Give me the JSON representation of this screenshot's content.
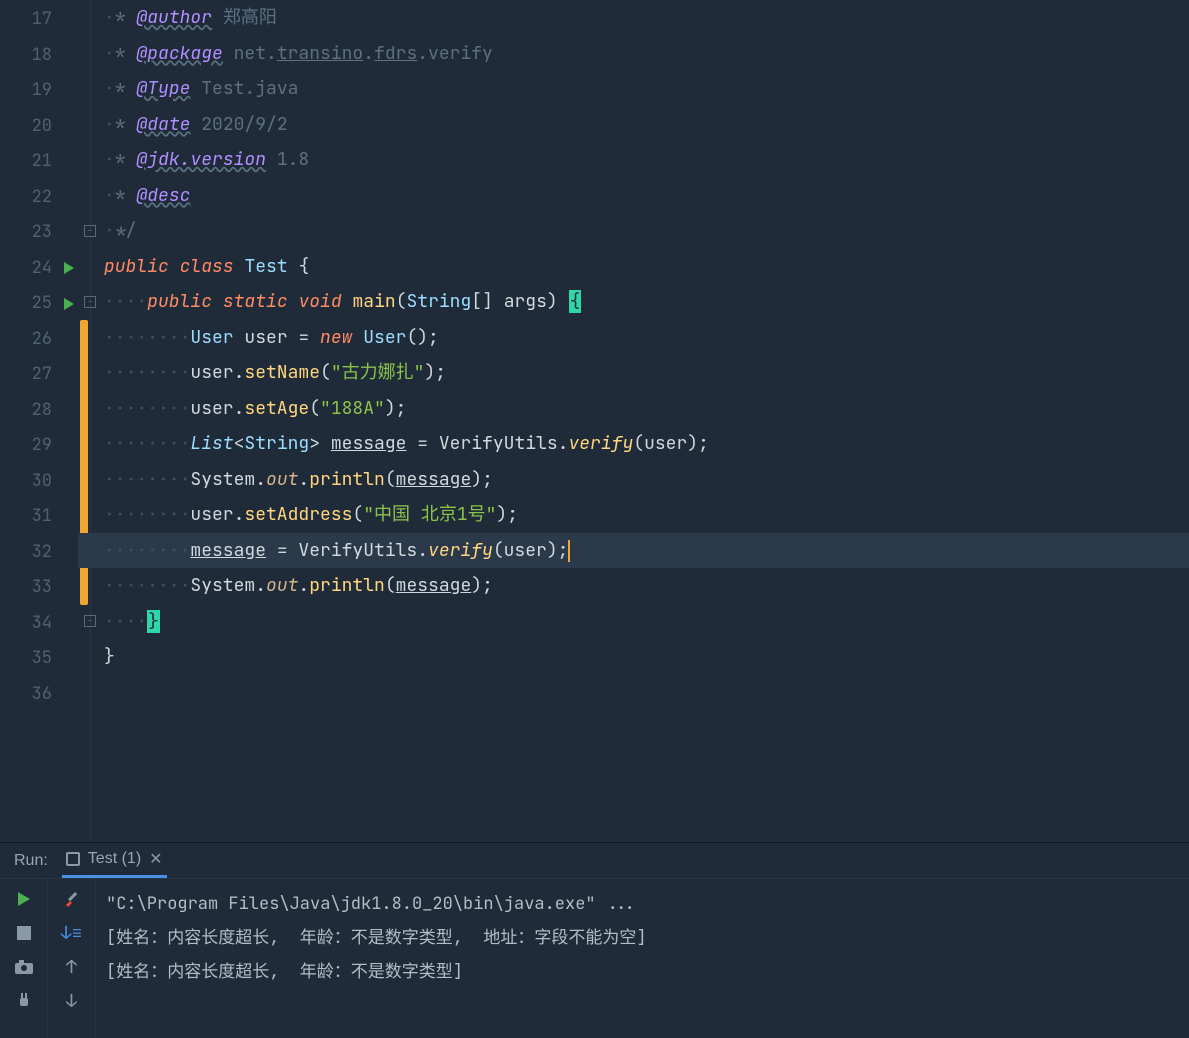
{
  "editor": {
    "first_line_no": 17,
    "lines": [
      {
        "no": 17,
        "html": "<span class='dots'>·</span><span class='comment'>* </span><span class='doctag'>@author</span><span class='comment'> 郑高阳</span>"
      },
      {
        "no": 18,
        "html": "<span class='dots'>·</span><span class='comment'>* </span><span class='doctag'>@package</span><span class='comment'> net.<span class='underline'>transino</span>.<span class='underline'>fdrs</span>.verify</span>"
      },
      {
        "no": 19,
        "html": "<span class='dots'>·</span><span class='comment'>* </span><span class='doctag'>@Type</span><span class='comment'> Test.java</span>"
      },
      {
        "no": 20,
        "html": "<span class='dots'>·</span><span class='comment'>* </span><span class='doctag'>@date</span><span class='comment'> 2020/9/2</span>"
      },
      {
        "no": 21,
        "html": "<span class='dots'>·</span><span class='comment'>* </span><span class='doctag'>@jdk.version</span><span class='comment'> 1.8</span>"
      },
      {
        "no": 22,
        "html": "<span class='dots'>·</span><span class='comment'>* </span><span class='doctag'>@desc</span>"
      },
      {
        "no": 23,
        "fold": "-",
        "html": "<span class='dots'>·</span><span class='comment'>*/</span>"
      },
      {
        "no": 24,
        "play": true,
        "html": "<span class='kw'>public</span> <span class='kw'>class</span> <span class='type'>Test</span> <span class='var'>{</span>"
      },
      {
        "no": 25,
        "play": true,
        "fold": "-",
        "html": "<span class='dots'>····</span><span class='kw'>public</span> <span class='kw'>static</span> <span class='kw'>void</span> <span class='method'>main</span><span class='var'>(</span><span class='type'>String</span><span class='var'>[] args) </span><span class='bracehl'>{</span>"
      },
      {
        "no": 26,
        "html": "<span class='dots'>········</span><span class='type'>User</span> <span class='var'>user = </span><span class='kw'>new</span> <span class='type'>User</span><span class='var'>();</span>"
      },
      {
        "no": 27,
        "html": "<span class='dots'>········</span><span class='var'>user.</span><span class='method'>setName</span><span class='var'>(</span><span class='str'>\"古力娜扎\"</span><span class='var'>);</span>"
      },
      {
        "no": 28,
        "html": "<span class='dots'>········</span><span class='var'>user.</span><span class='method'>setAge</span><span class='var'>(</span><span class='str'>\"188A\"</span><span class='var'>);</span>"
      },
      {
        "no": 29,
        "html": "<span class='dots'>········</span><span class='type' style='font-style:italic'>List</span><span class='var'>&lt;</span><span class='type'>String</span><span class='var'>&gt; </span><span class='var underline'>message</span><span class='var'> = VerifyUtils.</span><span class='call-it'>verify</span><span class='var'>(user);</span>"
      },
      {
        "no": 30,
        "html": "<span class='dots'>········</span><span class='var'>System.</span><span class='field'>out</span><span class='var'>.</span><span class='method'>println</span><span class='var'>(</span><span class='var underline'>message</span><span class='var'>);</span>"
      },
      {
        "no": 31,
        "html": "<span class='dots'>········</span><span class='var'>user.</span><span class='method'>setAddress</span><span class='var'>(</span><span class='str'>\"中国 北京1号\"</span><span class='var'>);</span>"
      },
      {
        "no": 32,
        "current": true,
        "html": "<span class='dots'>········</span><span class='var underline'>message</span><span class='var'> = VerifyUtils.</span><span class='call-it'>verify</span><span class='var'>(user);</span><span class='caret'></span>"
      },
      {
        "no": 33,
        "html": "<span class='dots'>········</span><span class='var'>System.</span><span class='field'>out</span><span class='var'>.</span><span class='method'>println</span><span class='var'>(</span><span class='var underline'>message</span><span class='var'>);</span>"
      },
      {
        "no": 34,
        "fold": "-",
        "html": "<span class='dots'>····</span><span class='bracehl'>}</span>"
      },
      {
        "no": 35,
        "html": "<span class='var'>}</span>"
      },
      {
        "no": 36,
        "html": ""
      }
    ]
  },
  "run": {
    "label": "Run:",
    "tab_name": "Test (1)",
    "console": [
      "\"C:\\Program Files\\Java\\jdk1.8.0_20\\bin\\java.exe\" ...",
      "[姓名：内容长度超长,  年龄：不是数字类型,  地址：字段不能为空]",
      "[姓名：内容长度超长,  年龄：不是数字类型]"
    ]
  }
}
